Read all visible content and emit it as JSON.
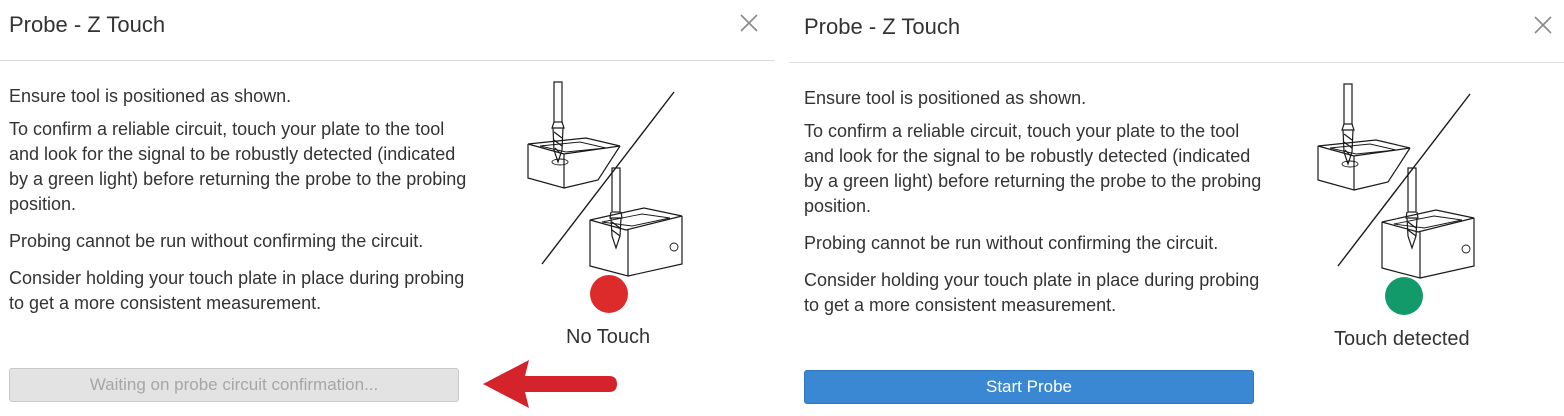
{
  "colors": {
    "no_touch": "#dd2a2a",
    "touch_detected": "#139a6a",
    "primary_button": "#3a87d4",
    "disabled_button": "#e3e3e3",
    "arrow": "#d4232a"
  },
  "left_dialog": {
    "title": "Probe - Z Touch",
    "close_icon": "close-icon",
    "paragraphs": [
      "Ensure tool is positioned as shown.",
      "To confirm a reliable circuit, touch your plate to the tool and look for the signal to be robustly detected (indicated by a green light) before returning the probe to the probing position.",
      "Probing cannot be run without confirming the circuit.",
      "Consider holding your touch plate in place during probing to get a more consistent measurement."
    ],
    "status_label": "No Touch",
    "button_label": "Waiting on probe circuit confirmation...",
    "button_disabled": true
  },
  "right_dialog": {
    "title": "Probe - Z Touch",
    "close_icon": "close-icon",
    "paragraphs": [
      "Ensure tool is positioned as shown.",
      "To confirm a reliable circuit, touch your plate to the tool and look for the signal to be robustly detected (indicated by a green light) before returning the probe to the probing position.",
      "Probing cannot be run without confirming the circuit.",
      "Consider holding your touch plate in place during probing to get a more consistent measurement."
    ],
    "status_label": "Touch detected",
    "button_label": "Start Probe",
    "button_disabled": false
  },
  "annotation": {
    "arrow_icon": "red-arrow-icon"
  }
}
